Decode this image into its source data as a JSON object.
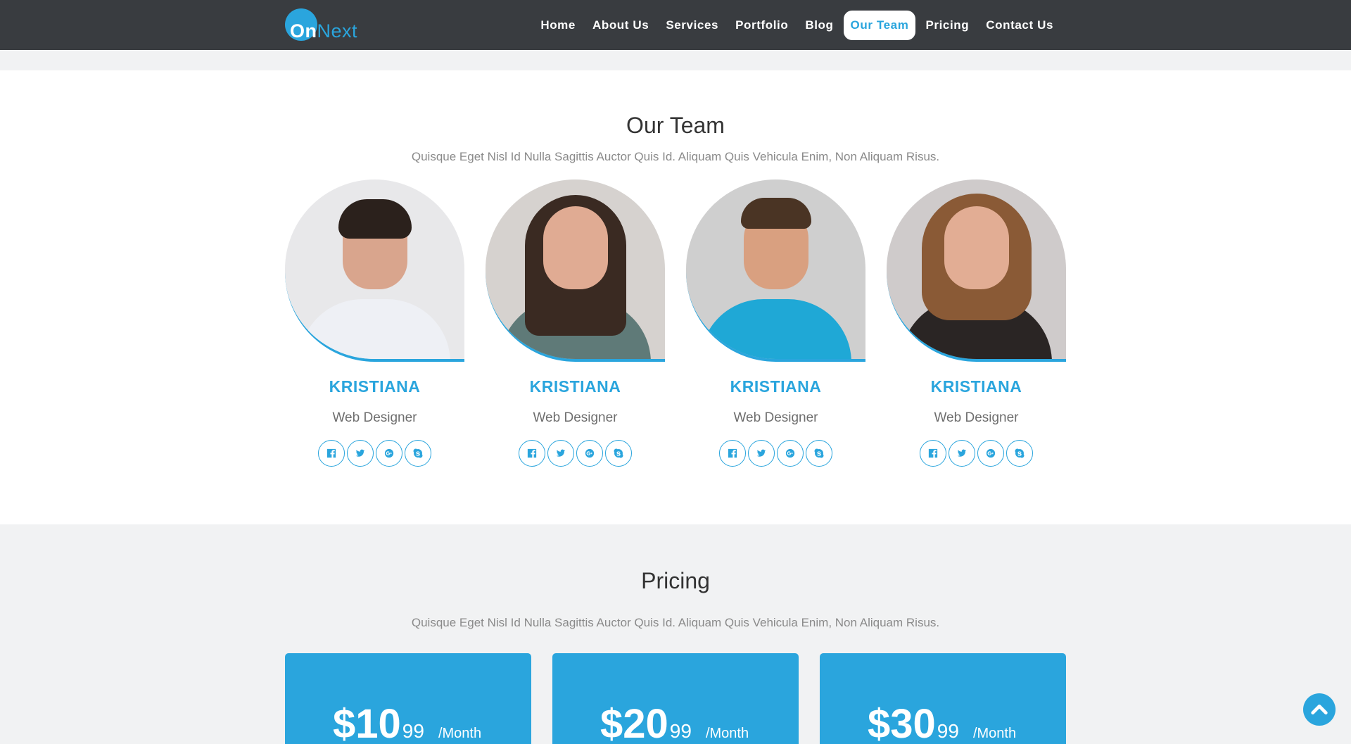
{
  "brand": {
    "part1": "On",
    "part2": "Next",
    "accent_color": "#2aa5dd"
  },
  "nav": {
    "items": [
      {
        "label": "Home",
        "active": false
      },
      {
        "label": "About Us",
        "active": false
      },
      {
        "label": "Services",
        "active": false
      },
      {
        "label": "Portfolio",
        "active": false
      },
      {
        "label": "Blog",
        "active": false
      },
      {
        "label": "Our Team",
        "active": true
      },
      {
        "label": "Pricing",
        "active": false
      },
      {
        "label": "Contact Us",
        "active": false
      }
    ]
  },
  "team": {
    "title": "Our Team",
    "subtitle": "Quisque Eget Nisl Id Nulla Sagittis Auctor Quis Id. Aliquam Quis Vehicula Enim, Non Aliquam Risus.",
    "members": [
      {
        "name": "KRISTIANA",
        "role": "Web Designer",
        "socials": [
          "facebook-icon",
          "twitter-icon",
          "google-plus-icon",
          "skype-icon"
        ]
      },
      {
        "name": "KRISTIANA",
        "role": "Web Designer",
        "socials": [
          "facebook-icon",
          "twitter-icon",
          "google-plus-icon",
          "skype-icon"
        ]
      },
      {
        "name": "KRISTIANA",
        "role": "Web Designer",
        "socials": [
          "facebook-icon",
          "twitter-icon",
          "google-plus-icon",
          "skype-icon"
        ]
      },
      {
        "name": "KRISTIANA",
        "role": "Web Designer",
        "socials": [
          "facebook-icon",
          "twitter-icon",
          "google-plus-icon",
          "skype-icon"
        ]
      }
    ]
  },
  "pricing": {
    "title": "Pricing",
    "subtitle": "Quisque Eget Nisl Id Nulla Sagittis Auctor Quis Id. Aliquam Quis Vehicula Enim, Non Aliquam Risus.",
    "plans": [
      {
        "price": "$10",
        "cents": "99",
        "period": "/Month"
      },
      {
        "price": "$20",
        "cents": "99",
        "period": "/Month"
      },
      {
        "price": "$30",
        "cents": "99",
        "period": "/Month"
      }
    ]
  },
  "scroll_top": {
    "icon": "chevron-up-icon"
  }
}
